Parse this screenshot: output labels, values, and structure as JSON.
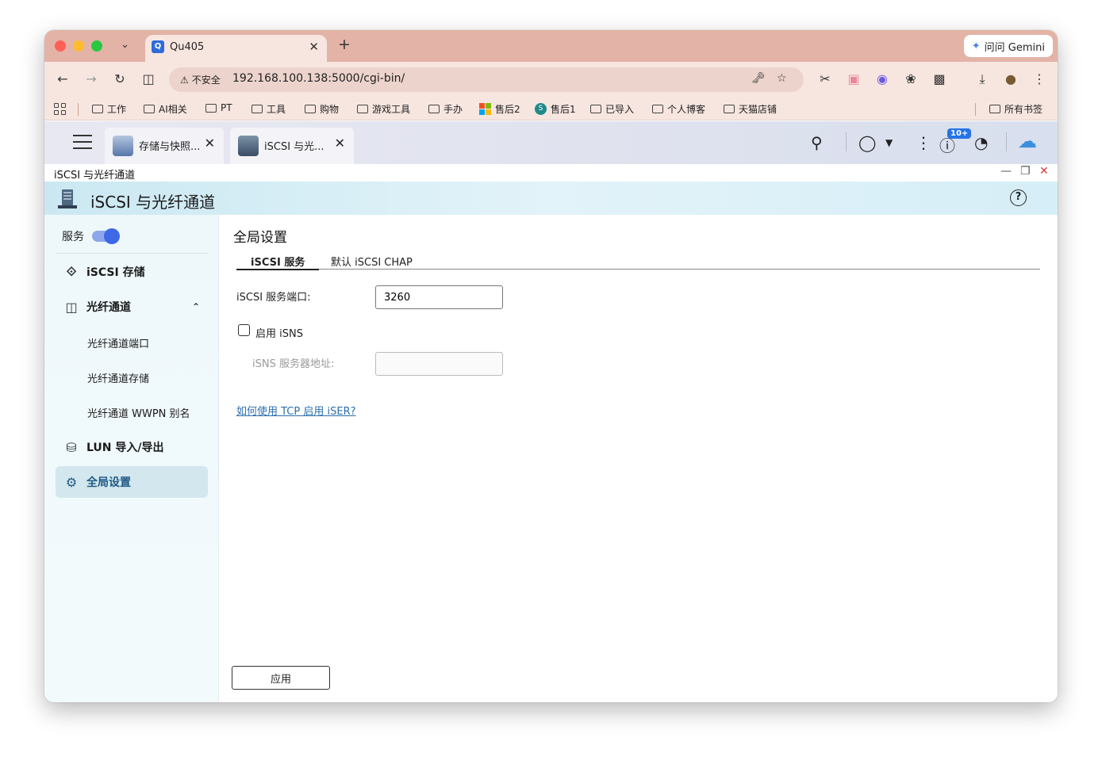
{
  "browser": {
    "tab_title": "Qu405",
    "tab_favicon": "Q",
    "gemini_label": "问问 Gemini",
    "security_label": "不安全",
    "url": "192.168.100.138:5000/cgi-bin/",
    "bookmarks": [
      "工作",
      "AI相关",
      "PT",
      "工具",
      "购物",
      "游戏工具",
      "手办",
      "售后2",
      "售后1",
      "已导入",
      "个人博客",
      "天猫店铺"
    ],
    "all_bookmarks": "所有书签"
  },
  "qnap": {
    "tabs": [
      {
        "label": "存储与快照..."
      },
      {
        "label": "iSCSI 与光..."
      }
    ],
    "badge": "10+"
  },
  "window": {
    "title": "iSCSI 与光纤通道",
    "app_name": "iSCSI 与光纤通道"
  },
  "sidebar": {
    "service_label": "服务",
    "items": [
      {
        "label": "iSCSI 存储"
      },
      {
        "label": "光纤通道"
      },
      {
        "label": "光纤通道端口"
      },
      {
        "label": "光纤通道存储"
      },
      {
        "label": "光纤通道 WWPN 别名"
      },
      {
        "label": "LUN 导入/导出"
      },
      {
        "label": "全局设置"
      }
    ]
  },
  "content": {
    "section_title": "全局设置",
    "tabs": [
      {
        "label": "iSCSI 服务"
      },
      {
        "label": "默认 iSCSI CHAP"
      }
    ],
    "port_label": "iSCSI 服务端口:",
    "port_value": "3260",
    "isns_checkbox_label": "启用 iSNS",
    "isns_checked": false,
    "isns_server_label": "iSNS 服务器地址:",
    "isns_server_value": "",
    "link_text": "如何使用 TCP 启用 iSER?",
    "apply_label": "应用"
  },
  "colors": {
    "accent": "#3d68e6",
    "active_nav_bg": "#d3e7ee",
    "active_nav_text": "#1f5a86",
    "link": "#2a6fb0",
    "tabstrip": "#e2b3a6"
  }
}
